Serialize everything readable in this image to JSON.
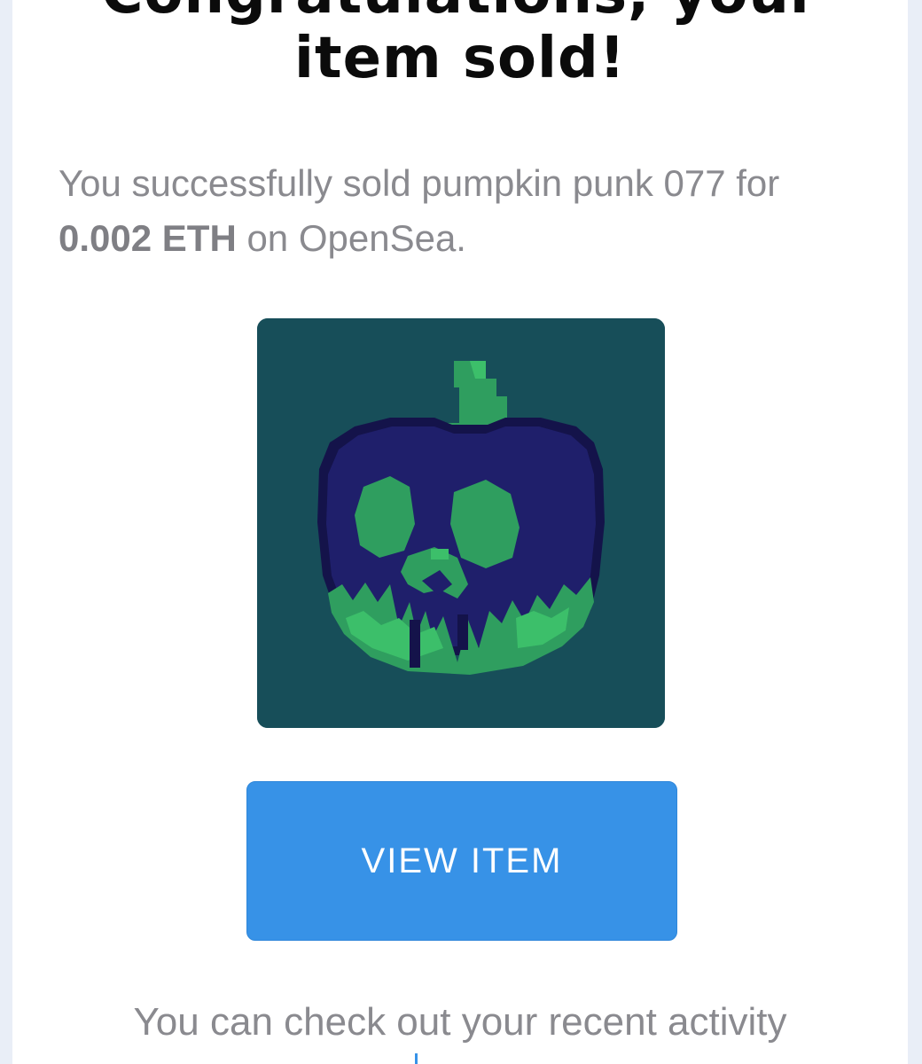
{
  "email": {
    "headline_top": "Congratulations, your",
    "headline": "item sold!",
    "message": {
      "prefix": "You successfully sold pumpkin punk 077 for ",
      "price": "0.002 ETH",
      "suffix": " on OpenSea."
    },
    "item_image_alt": "pumpkin punk 077",
    "button_label": "VIEW ITEM",
    "activity_text": "You can check out your recent activity"
  },
  "colors": {
    "button": "#3792e7",
    "image_background": "#174e59",
    "pumpkin_body": "#1f1f6b",
    "pumpkin_outline": "#14134a",
    "pumpkin_green": "#2f9e5f",
    "pumpkin_light_green": "#3cbf6a"
  }
}
